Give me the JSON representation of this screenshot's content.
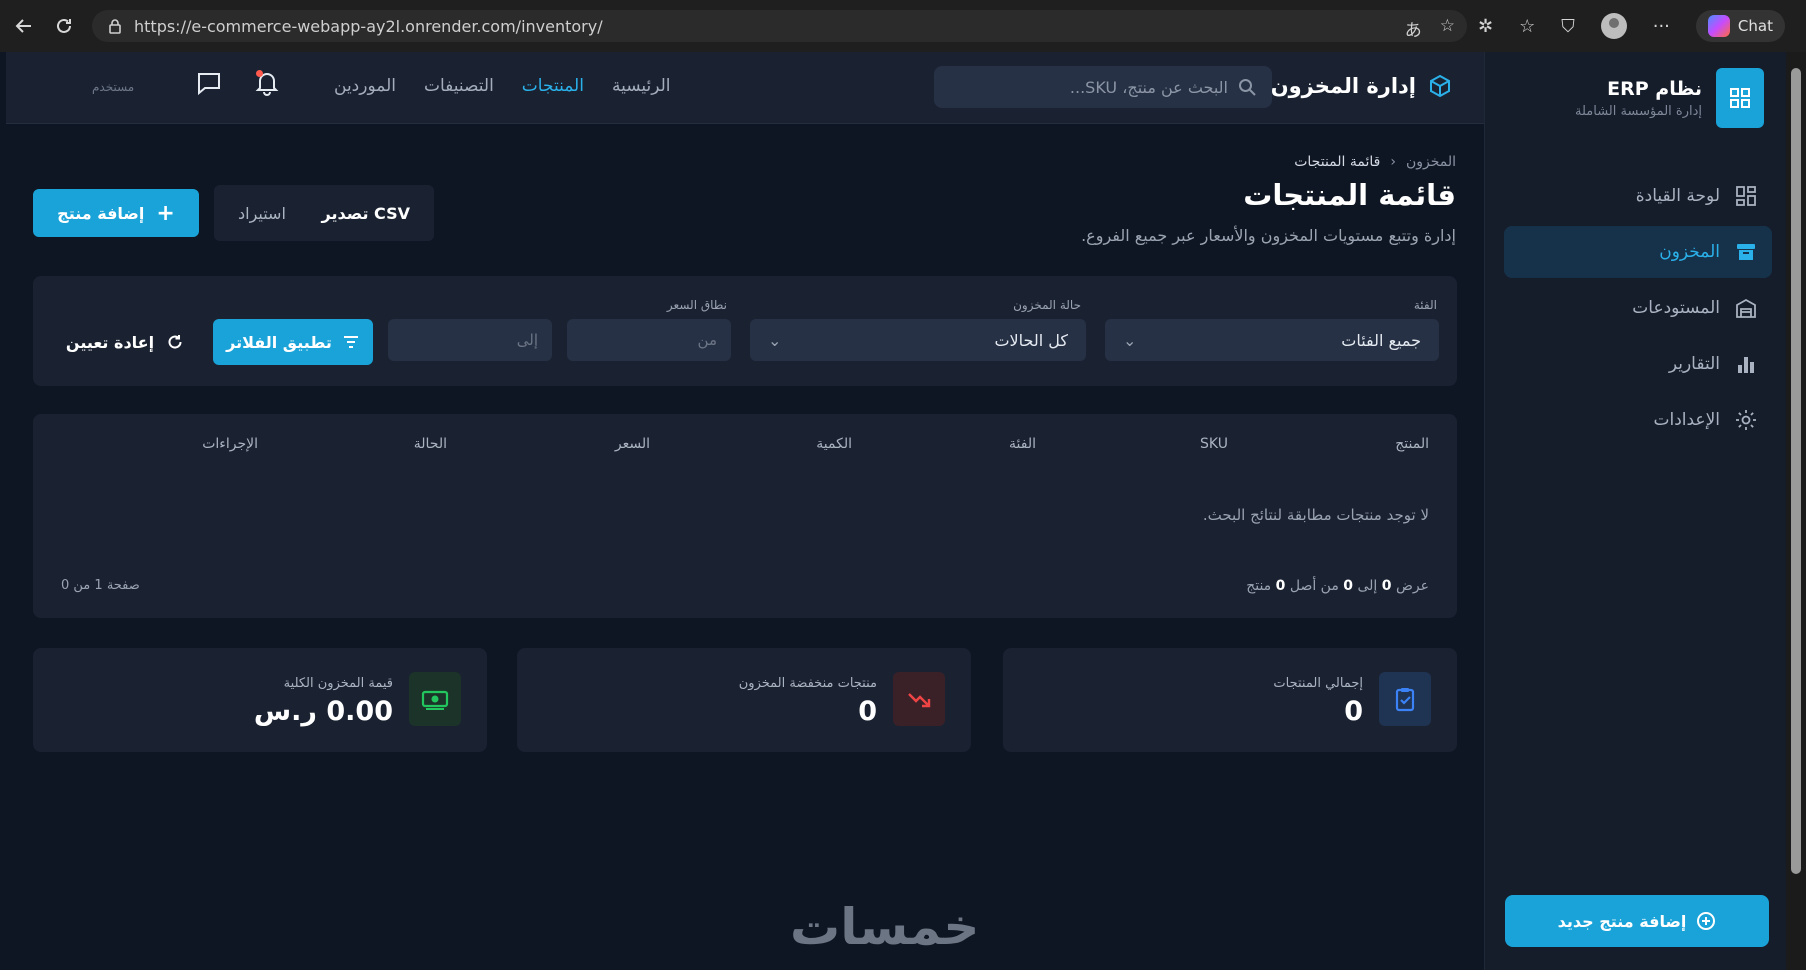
{
  "browser": {
    "url": "https://e-commerce-webapp-ay2l.onrender.com/inventory/",
    "chat_label": "Chat"
  },
  "sidebar": {
    "brand_title": "نظام ERP",
    "brand_subtitle": "إدارة المؤسسة الشاملة",
    "items": [
      {
        "label": "لوحة القيادة",
        "icon": "dashboard-icon",
        "active": false
      },
      {
        "label": "المخزون",
        "icon": "archive-icon",
        "active": true
      },
      {
        "label": "المستودعات",
        "icon": "warehouse-icon",
        "active": false
      },
      {
        "label": "التقارير",
        "icon": "chart-icon",
        "active": false
      },
      {
        "label": "الإعدادات",
        "icon": "gear-icon",
        "active": false
      }
    ],
    "add_button": "إضافة منتج جديد"
  },
  "header": {
    "title": "إدارة المخزون",
    "search_placeholder": "البحث عن منتج، SKU...",
    "nav": [
      {
        "label": "الرئيسية",
        "active": false
      },
      {
        "label": "المنتجات",
        "active": true
      },
      {
        "label": "التصنيفات",
        "active": false
      },
      {
        "label": "الموردين",
        "active": false
      }
    ],
    "user_label": "مستخدم"
  },
  "page": {
    "breadcrumb": [
      "المخزون",
      "قائمة المنتجات"
    ],
    "title": "قائمة المنتجات",
    "description": "إدارة وتتبع مستويات المخزون والأسعار عبر جميع الفروع.",
    "add_button": "إضافة منتج",
    "export_button": "تصدير CSV",
    "import_button": "استيراد"
  },
  "filters": {
    "category_label": "الفئة",
    "category_value": "جميع الفئات",
    "status_label": "حالة المخزون",
    "status_value": "كل الحالات",
    "price_label": "نطاق السعر",
    "price_from_placeholder": "من",
    "price_to_placeholder": "إلى",
    "apply_button": "تطبيق الفلاتر",
    "reset_button": "إعادة تعيين"
  },
  "table": {
    "columns": [
      "المنتج",
      "SKU",
      "الفئة",
      "الكمية",
      "السعر",
      "الحالة",
      "الإجراءات"
    ],
    "empty_message": "لا توجد منتجات مطابقة لنتائج البحث.",
    "footer_prefix": "عرض",
    "footer_from": "0",
    "footer_to_word": "إلى",
    "footer_to": "0",
    "footer_of_word": "من أصل",
    "footer_total": "0",
    "footer_suffix": "منتج",
    "pagination": "صفحة 1 من 0"
  },
  "stats": [
    {
      "label": "إجمالي المنتجات",
      "value": "0",
      "icon": "clipboard-check-icon",
      "color": "#3b82f6"
    },
    {
      "label": "منتجات منخفضة المخزون",
      "value": "0",
      "icon": "trend-down-icon",
      "color": "#ef4444"
    },
    {
      "label": "قيمة المخزون الكلية",
      "value": "0.00 ر.س",
      "icon": "cash-icon",
      "color": "#22c55e"
    }
  ],
  "watermark": "خمسات",
  "colors": {
    "accent": "#1aa3d8",
    "background": "#0f1623",
    "panel": "#1a2232"
  }
}
